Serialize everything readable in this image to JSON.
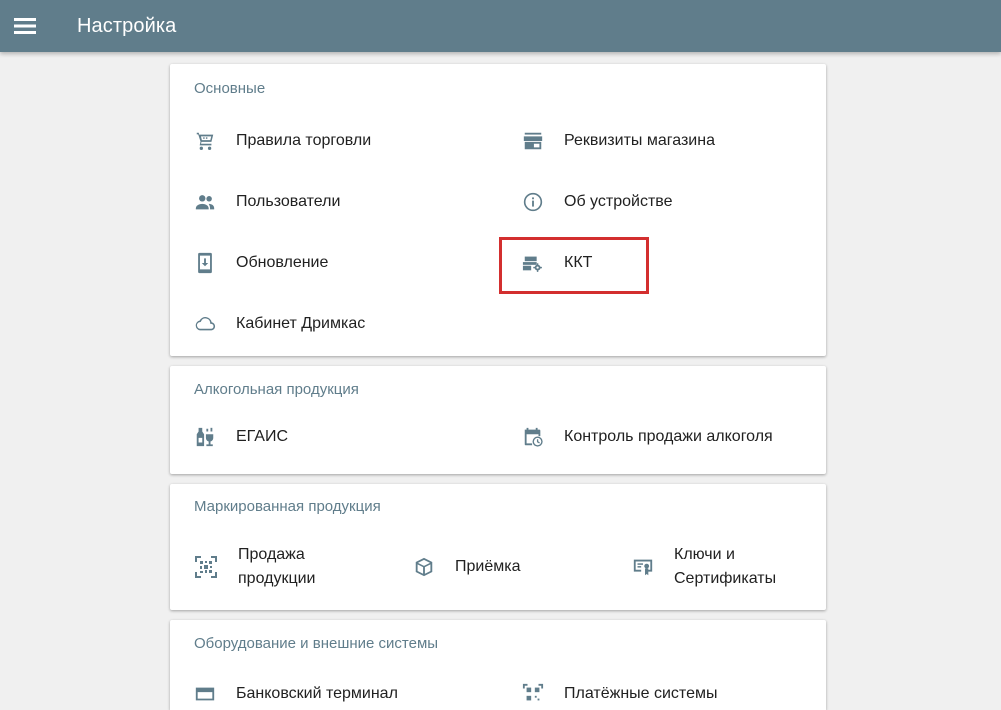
{
  "appbar": {
    "title": "Настройка",
    "menu_icon": "menu-icon",
    "color": "#607d8b"
  },
  "sections": {
    "basic": {
      "title": "Основные",
      "items": [
        {
          "label": "Правила торговли",
          "icon": "shopping-cart-icon"
        },
        {
          "label": "Реквизиты магазина",
          "icon": "store-icon"
        },
        {
          "label": "Пользователи",
          "icon": "users-icon"
        },
        {
          "label": "Об устройстве",
          "icon": "info-icon"
        },
        {
          "label": "Обновление",
          "icon": "phone-download-icon"
        },
        {
          "label": "ККТ",
          "icon": "kkt-settings-icon"
        },
        {
          "label": "Кабинет Дримкас",
          "icon": "cloud-icon"
        }
      ]
    },
    "alcohol": {
      "title": "Алкогольная продукция",
      "items": [
        {
          "label": "ЕГАИС",
          "icon": "bottles-icon"
        },
        {
          "label": "Контроль продажи алкоголя",
          "icon": "calendar-clock-icon"
        }
      ]
    },
    "marked": {
      "title": "Маркированная продукция",
      "items": [
        {
          "label": "Продажа продукции",
          "icon": "datamatrix-scan-icon"
        },
        {
          "label": "Приёмка",
          "icon": "package-icon"
        },
        {
          "label": "Ключи и Сертификаты",
          "icon": "certificate-icon"
        }
      ]
    },
    "equipment": {
      "title": "Оборудование и внешние системы",
      "items": [
        {
          "label": "Банковский терминал",
          "icon": "card-terminal-icon"
        },
        {
          "label": "Платёжные системы",
          "icon": "qr-code-icon"
        }
      ]
    }
  },
  "highlight_color": "#d32f2f"
}
